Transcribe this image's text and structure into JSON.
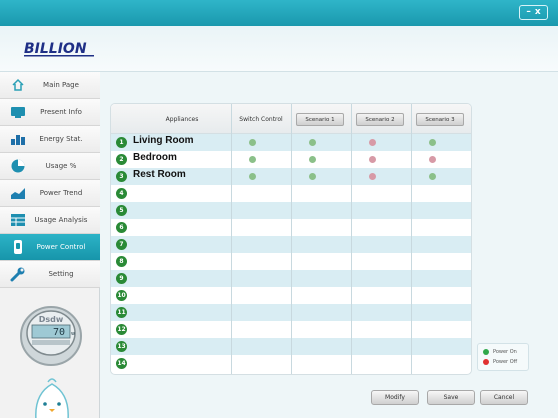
{
  "window": {
    "minimize_glyph": "–",
    "close_glyph": "x"
  },
  "brand": {
    "logo_text": "BILLION"
  },
  "sidebar": {
    "items": [
      {
        "label": "Main Page",
        "icon": "home-icon"
      },
      {
        "label": "Present Info",
        "icon": "monitor-icon"
      },
      {
        "label": "Energy Stat.",
        "icon": "bar-chart-icon"
      },
      {
        "label": "Usage %",
        "icon": "pie-chart-icon"
      },
      {
        "label": "Power Trend",
        "icon": "trend-icon"
      },
      {
        "label": "Usage Analysis",
        "icon": "table-icon"
      },
      {
        "label": "Power Control",
        "icon": "plug-icon",
        "active": true
      },
      {
        "label": "Setting",
        "icon": "wrench-icon"
      }
    ],
    "meter": {
      "reading": "70",
      "unit": "w"
    }
  },
  "table": {
    "col_appliances": "Appliances",
    "col_switch": "Switch Control",
    "scenario_buttons": [
      "Scenario 1",
      "Scenario 2",
      "Scenario 3"
    ],
    "rows": [
      {
        "num": "1",
        "name": "Living Room",
        "states": [
          "on",
          "on",
          "off",
          "on"
        ]
      },
      {
        "num": "2",
        "name": "Bedroom",
        "states": [
          "on",
          "on",
          "off",
          "off"
        ]
      },
      {
        "num": "3",
        "name": "Rest Room",
        "states": [
          "on",
          "on",
          "off",
          "on"
        ]
      },
      {
        "num": "4",
        "name": "",
        "states": []
      },
      {
        "num": "5",
        "name": "",
        "states": []
      },
      {
        "num": "6",
        "name": "",
        "states": []
      },
      {
        "num": "7",
        "name": "",
        "states": []
      },
      {
        "num": "8",
        "name": "",
        "states": []
      },
      {
        "num": "9",
        "name": "",
        "states": []
      },
      {
        "num": "10",
        "name": "",
        "states": []
      },
      {
        "num": "11",
        "name": "",
        "states": []
      },
      {
        "num": "12",
        "name": "",
        "states": []
      },
      {
        "num": "13",
        "name": "",
        "states": []
      },
      {
        "num": "14",
        "name": "",
        "states": []
      }
    ]
  },
  "legend": {
    "on_label": "Power On",
    "off_label": "Power Off"
  },
  "buttons": {
    "modify": "Modify",
    "save": "Save",
    "cancel": "Cancel"
  },
  "colors": {
    "accent": "#1fa6bb",
    "on": "#8bc089",
    "off": "#d79aa6",
    "row_alt": "#d9edf3"
  }
}
